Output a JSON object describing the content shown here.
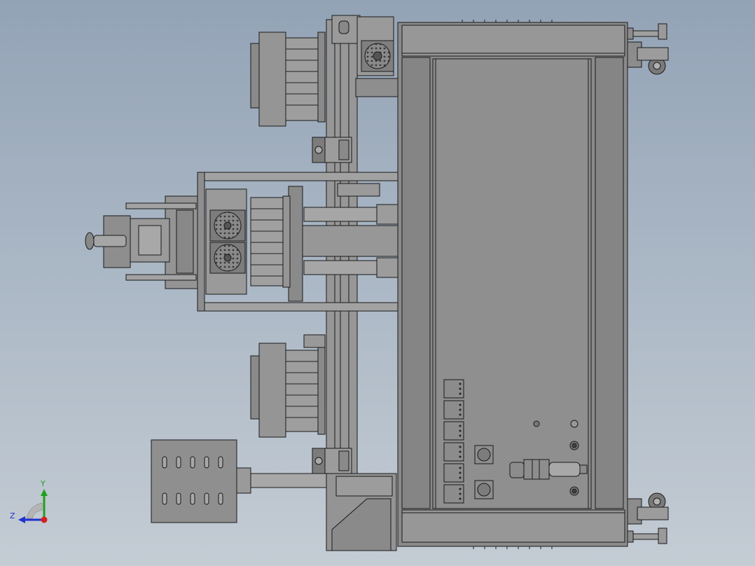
{
  "viewport": {
    "view_orientation": "front",
    "colors": {
      "background_top": "#93a3b6",
      "background_bottom": "#c4ccd4",
      "model_fill": "#8c8c8c",
      "model_fill_light": "#a4a4a4",
      "model_fill_dark": "#6e6e6e",
      "edge": "#1a1a1a"
    }
  },
  "triad": {
    "x_axis_color": "#d42020",
    "y_axis_color": "#1ea01e",
    "z_axis_color": "#2030d0",
    "y_label": "Y",
    "z_label": "Z"
  }
}
